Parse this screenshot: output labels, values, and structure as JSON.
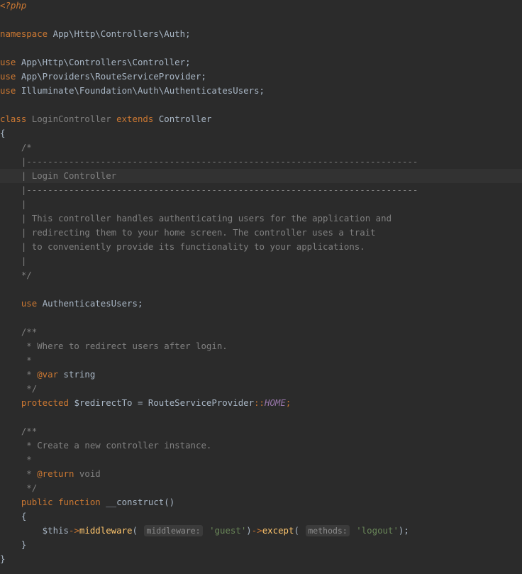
{
  "editor": {
    "current_line": 12,
    "lines": [
      [
        {
          "t": "<?php",
          "c": "tag"
        }
      ],
      [],
      [
        {
          "t": "namespace ",
          "c": "kw"
        },
        {
          "t": "App\\Http\\Controllers\\Auth;",
          "c": "plain"
        }
      ],
      [],
      [
        {
          "t": "use ",
          "c": "kw"
        },
        {
          "t": "App\\Http\\Controllers\\Controller;",
          "c": "plain"
        }
      ],
      [
        {
          "t": "use ",
          "c": "kw"
        },
        {
          "t": "App\\Providers\\RouteServiceProvider;",
          "c": "plain"
        }
      ],
      [
        {
          "t": "use ",
          "c": "kw"
        },
        {
          "t": "Illuminate\\Foundation\\Auth\\AuthenticatesUsers;",
          "c": "plain"
        }
      ],
      [],
      [
        {
          "t": "class ",
          "c": "kw"
        },
        {
          "t": "LoginController ",
          "c": "fade"
        },
        {
          "t": "extends ",
          "c": "kw"
        },
        {
          "t": "Controller",
          "c": "plain"
        }
      ],
      [
        {
          "t": "{",
          "c": "plain"
        }
      ],
      [
        {
          "t": "    /*",
          "c": "comment"
        }
      ],
      [
        {
          "t": "    |--------------------------------------------------------------------------",
          "c": "comment"
        }
      ],
      [
        {
          "t": "    | Login Controller",
          "c": "comment"
        }
      ],
      [
        {
          "t": "    |--------------------------------------------------------------------------",
          "c": "comment"
        }
      ],
      [
        {
          "t": "    |",
          "c": "comment"
        }
      ],
      [
        {
          "t": "    | This controller handles authenticating users for the application and",
          "c": "comment"
        }
      ],
      [
        {
          "t": "    | redirecting them to your home screen. The controller uses a trait",
          "c": "comment"
        }
      ],
      [
        {
          "t": "    | to conveniently provide its functionality to your applications.",
          "c": "comment"
        }
      ],
      [
        {
          "t": "    |",
          "c": "comment"
        }
      ],
      [
        {
          "t": "    */",
          "c": "comment"
        }
      ],
      [],
      [
        {
          "t": "    use ",
          "c": "kw"
        },
        {
          "t": "AuthenticatesUsers;",
          "c": "plain"
        }
      ],
      [],
      [
        {
          "t": "    /**",
          "c": "comment"
        }
      ],
      [
        {
          "t": "     * Where to redirect users after login.",
          "c": "comment"
        }
      ],
      [
        {
          "t": "     *",
          "c": "comment"
        }
      ],
      [
        {
          "t": "     * ",
          "c": "comment"
        },
        {
          "t": "@var",
          "c": "doctag"
        },
        {
          "t": " string",
          "c": "plain"
        }
      ],
      [
        {
          "t": "     */",
          "c": "comment"
        }
      ],
      [
        {
          "t": "    protected ",
          "c": "kw"
        },
        {
          "t": "$redirectTo = RouteServiceProvider",
          "c": "plain"
        },
        {
          "t": "::",
          "c": "kw"
        },
        {
          "t": "HOME",
          "c": "const"
        },
        {
          "t": ";",
          "c": "kw"
        }
      ],
      [],
      [
        {
          "t": "    /**",
          "c": "comment"
        }
      ],
      [
        {
          "t": "     * Create a new controller instance.",
          "c": "comment"
        }
      ],
      [
        {
          "t": "     *",
          "c": "comment"
        }
      ],
      [
        {
          "t": "     * ",
          "c": "comment"
        },
        {
          "t": "@return",
          "c": "doctag"
        },
        {
          "t": " void",
          "c": "docvoid"
        }
      ],
      [
        {
          "t": "     */",
          "c": "comment"
        }
      ],
      [
        {
          "t": "    public ",
          "c": "kw"
        },
        {
          "t": "function ",
          "c": "kw"
        },
        {
          "t": "__construct()",
          "c": "plain"
        }
      ],
      [
        {
          "t": "    {",
          "c": "plain"
        }
      ],
      [
        {
          "t": "        $this",
          "c": "plain"
        },
        {
          "t": "->",
          "c": "kw"
        },
        {
          "t": "middleware",
          "c": "fn"
        },
        {
          "t": "( ",
          "c": "plain"
        },
        {
          "t": "middleware:",
          "c": "hint"
        },
        {
          "t": " 'guest'",
          "c": "str"
        },
        {
          "t": ")",
          "c": "plain"
        },
        {
          "t": "->",
          "c": "kw"
        },
        {
          "t": "except",
          "c": "fn"
        },
        {
          "t": "( ",
          "c": "plain"
        },
        {
          "t": "methods:",
          "c": "hint"
        },
        {
          "t": " 'logout'",
          "c": "str"
        },
        {
          "t": ");",
          "c": "plain"
        }
      ],
      [
        {
          "t": "    }",
          "c": "plain"
        }
      ],
      [
        {
          "t": "}",
          "c": "plain"
        }
      ]
    ]
  }
}
